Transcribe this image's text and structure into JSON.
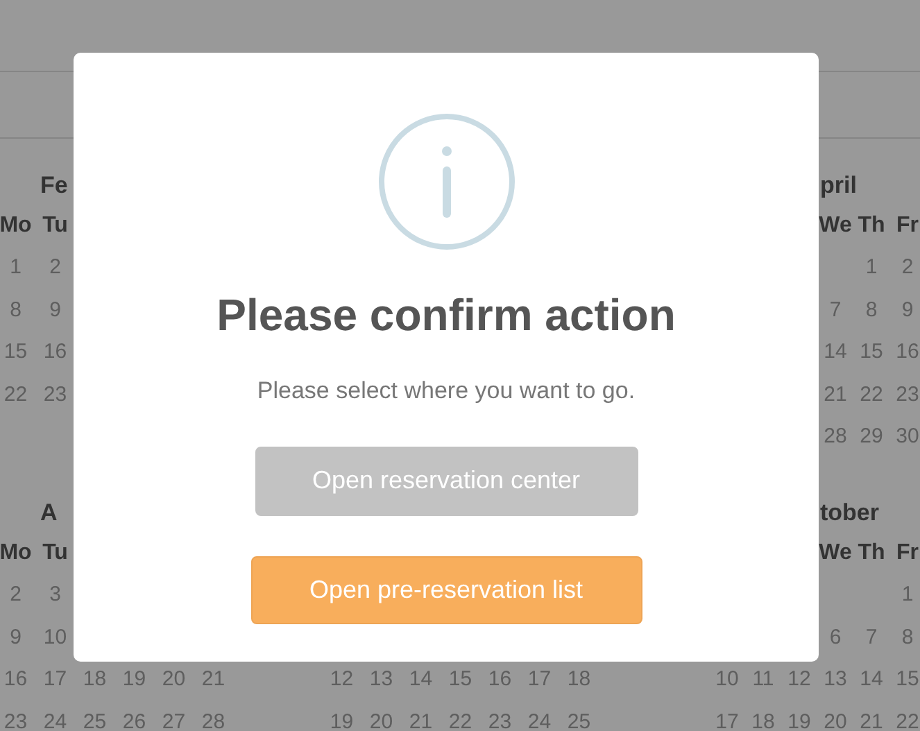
{
  "calendar_rows": [
    {
      "months": [
        {
          "kind": "left",
          "title": "Fe",
          "weekdays": [
            "Mo",
            "Tu"
          ],
          "weeks": [
            [
              "1",
              "2"
            ],
            [
              "8",
              "9"
            ],
            [
              "15",
              "16"
            ],
            [
              "22",
              "23"
            ]
          ]
        },
        {
          "kind": "right",
          "title": "pril",
          "weekdays": [
            "We",
            "Th",
            "Fr"
          ],
          "weeks": [
            [
              "1",
              "2"
            ],
            [
              "7",
              "8",
              "9"
            ],
            [
              "14",
              "15",
              "16"
            ],
            [
              "21",
              "22",
              "23"
            ],
            [
              "28",
              "29",
              "30"
            ]
          ]
        }
      ]
    },
    {
      "months": [
        {
          "kind": "left",
          "title": "A",
          "weekdays": [
            "Mo",
            "Tu"
          ],
          "weeks": [
            [
              "2",
              "3"
            ],
            [
              "9",
              "10"
            ],
            [
              "16",
              "17",
              "18",
              "19",
              "20",
              "21"
            ],
            [
              "23",
              "24",
              "25",
              "26",
              "27",
              "28"
            ]
          ]
        },
        {
          "kind": "center",
          "weeks": [
            [
              "12",
              "13",
              "14",
              "15",
              "16",
              "17",
              "18"
            ],
            [
              "19",
              "20",
              "21",
              "22",
              "23",
              "24",
              "25"
            ]
          ]
        },
        {
          "kind": "right",
          "title": "tober",
          "weekdays": [
            "We",
            "Th",
            "Fr"
          ],
          "weeks": [
            [
              "1"
            ],
            [
              "6",
              "7",
              "8"
            ],
            [
              "10",
              "11",
              "12",
              "13",
              "14",
              "15"
            ],
            [
              "17",
              "18",
              "19",
              "20",
              "21",
              "22"
            ]
          ]
        }
      ]
    }
  ],
  "dialog": {
    "title": "Please confirm action",
    "message": "Please select where you want to go.",
    "buttons": [
      {
        "label": "Open reservation center",
        "kind": "secondary"
      },
      {
        "label": "Open pre-reservation list",
        "kind": "primary"
      }
    ]
  }
}
